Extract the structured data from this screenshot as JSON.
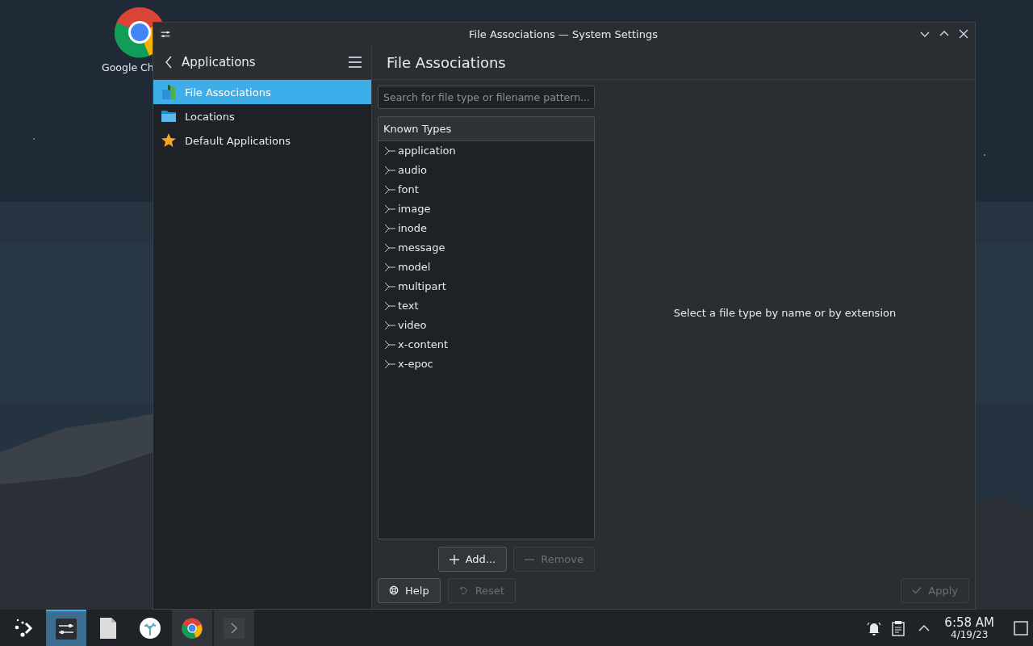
{
  "desktop": {
    "icons": [
      {
        "label": "Google Ch"
      }
    ]
  },
  "window": {
    "title": "File Associations — System Settings"
  },
  "sidebar": {
    "title": "Applications",
    "items": [
      {
        "label": "File Associations",
        "selected": true
      },
      {
        "label": "Locations",
        "selected": false
      },
      {
        "label": "Default Applications",
        "selected": false
      }
    ]
  },
  "page": {
    "title": "File Associations",
    "search": {
      "placeholder": "Search for file type or filename pattern..."
    },
    "tree": {
      "header": "Known Types",
      "items": [
        {
          "label": "application",
          "expanded": false
        },
        {
          "label": "audio",
          "expanded": false
        },
        {
          "label": "font",
          "expanded": false
        },
        {
          "label": "image",
          "expanded": false
        },
        {
          "label": "inode",
          "expanded": false
        },
        {
          "label": "message",
          "expanded": false
        },
        {
          "label": "model",
          "expanded": false
        },
        {
          "label": "multipart",
          "expanded": false
        },
        {
          "label": "text",
          "expanded": false
        },
        {
          "label": "video",
          "expanded": false
        },
        {
          "label": "x-content",
          "expanded": false
        },
        {
          "label": "x-epoc",
          "expanded": false
        }
      ]
    },
    "add_button": {
      "label": "Add...",
      "disabled": false
    },
    "remove_button": {
      "label": "Remove",
      "disabled": true
    },
    "message": "Select a file type by name or by extension"
  },
  "footer": {
    "help": {
      "label": "Help",
      "disabled": false
    },
    "reset": {
      "label": "Reset",
      "disabled": true
    },
    "apply": {
      "label": "Apply",
      "disabled": true
    }
  },
  "taskbar": {
    "tasks": [
      {
        "kind": "launcher",
        "selected": false
      },
      {
        "kind": "settings",
        "selected": true
      },
      {
        "kind": "file",
        "selected": false
      },
      {
        "kind": "discover",
        "selected": false
      },
      {
        "kind": "chrome",
        "selected": false
      },
      {
        "kind": "terminal",
        "selected": false
      }
    ],
    "clock": {
      "time": "6:58 AM",
      "date": "4/19/23"
    }
  }
}
